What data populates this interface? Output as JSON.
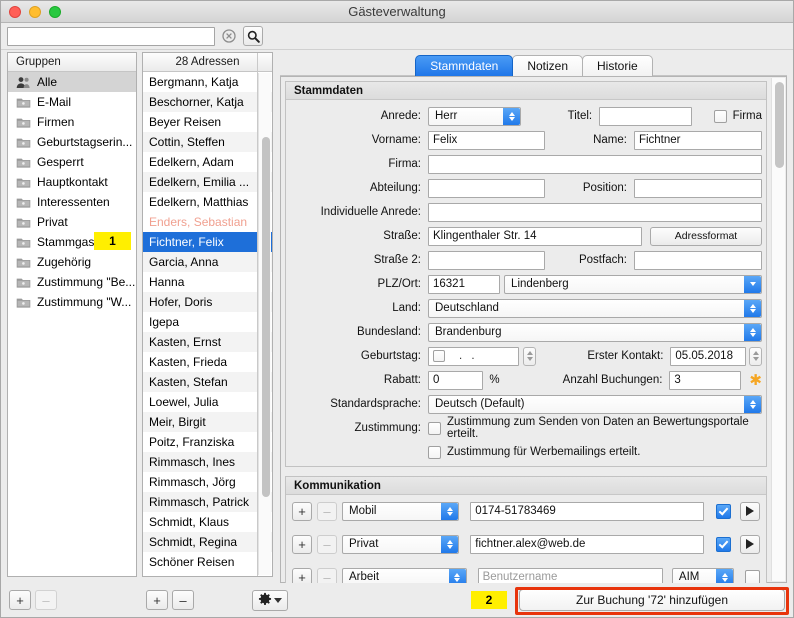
{
  "window": {
    "title": "Gästeverwaltung"
  },
  "toolbar": {
    "search_value": "",
    "search_placeholder": "",
    "clear_icon": "clear-circle-icon",
    "search_icon": "magnifier-icon"
  },
  "groups": {
    "header": "Gruppen",
    "items": [
      {
        "label": "Alle",
        "icon": "people-icon",
        "selected": true
      },
      {
        "label": "E-Mail",
        "icon": "folder-icon",
        "selected": false
      },
      {
        "label": "Firmen",
        "icon": "folder-icon",
        "selected": false
      },
      {
        "label": "Geburtstagserin...",
        "icon": "folder-icon",
        "selected": false
      },
      {
        "label": "Gesperrt",
        "icon": "folder-icon",
        "selected": false
      },
      {
        "label": "Hauptkontakt",
        "icon": "folder-icon",
        "selected": false
      },
      {
        "label": "Interessenten",
        "icon": "folder-icon",
        "selected": false
      },
      {
        "label": "Privat",
        "icon": "folder-icon",
        "selected": false
      },
      {
        "label": "Stammgast",
        "icon": "folder-icon",
        "selected": false
      },
      {
        "label": "Zugehörig",
        "icon": "folder-icon",
        "selected": false
      },
      {
        "label": "Zustimmung \"Be...",
        "icon": "folder-icon",
        "selected": false
      },
      {
        "label": "Zustimmung \"W...",
        "icon": "folder-icon",
        "selected": false
      }
    ]
  },
  "addresses": {
    "header": "28 Adressen",
    "items": [
      {
        "label": "Bergmann, Katja",
        "state": "normal"
      },
      {
        "label": "Beschorner, Katja",
        "state": "normal"
      },
      {
        "label": "Beyer Reisen",
        "state": "normal"
      },
      {
        "label": "Cottin, Steffen",
        "state": "normal"
      },
      {
        "label": "Edelkern, Adam",
        "state": "normal"
      },
      {
        "label": "Edelkern, Emilia ...",
        "state": "normal"
      },
      {
        "label": "Edelkern, Matthias",
        "state": "normal"
      },
      {
        "label": "Enders, Sebastian",
        "state": "disabled"
      },
      {
        "label": "Fichtner, Felix",
        "state": "selected"
      },
      {
        "label": "Garcia, Anna",
        "state": "normal"
      },
      {
        "label": "Hanna",
        "state": "normal"
      },
      {
        "label": "Hofer, Doris",
        "state": "normal"
      },
      {
        "label": "Igepa",
        "state": "normal"
      },
      {
        "label": "Kasten, Ernst",
        "state": "normal"
      },
      {
        "label": "Kasten, Frieda",
        "state": "normal"
      },
      {
        "label": "Kasten, Stefan",
        "state": "normal"
      },
      {
        "label": "Loewel, Julia",
        "state": "normal"
      },
      {
        "label": "Meir, Birgit",
        "state": "normal"
      },
      {
        "label": "Poitz, Franziska",
        "state": "normal"
      },
      {
        "label": "Rimmasch, Ines",
        "state": "normal"
      },
      {
        "label": "Rimmasch, Jörg",
        "state": "normal"
      },
      {
        "label": "Rimmasch, Patrick",
        "state": "normal"
      },
      {
        "label": "Schmidt, Klaus",
        "state": "normal"
      },
      {
        "label": "Schmidt, Regina",
        "state": "normal"
      },
      {
        "label": "Schöner Reisen",
        "state": "normal"
      }
    ]
  },
  "tabs": [
    {
      "label": "Stammdaten",
      "active": true
    },
    {
      "label": "Notizen",
      "active": false
    },
    {
      "label": "Historie",
      "active": false
    }
  ],
  "stammdaten": {
    "section_title": "Stammdaten",
    "anrede_label": "Anrede:",
    "anrede_value": "Herr",
    "titel_label": "Titel:",
    "titel_value": "",
    "firma_checkbox_label": "Firma",
    "vorname_label": "Vorname:",
    "vorname_value": "Felix",
    "name_label": "Name:",
    "name_value": "Fichtner",
    "firma_label": "Firma:",
    "firma_value": "",
    "abteilung_label": "Abteilung:",
    "abteilung_value": "",
    "position_label": "Position:",
    "position_value": "",
    "individuelle_anrede_label": "Individuelle Anrede:",
    "individuelle_anrede_value": "",
    "strasse_label": "Straße:",
    "strasse_value": "Klingenthaler Str. 14",
    "adressformat_button": "Adressformat",
    "strasse2_label": "Straße 2:",
    "strasse2_value": "",
    "postfach_label": "Postfach:",
    "postfach_value": "",
    "plz_ort_label": "PLZ/Ort:",
    "plz_value": "16321",
    "ort_value": "Lindenberg",
    "land_label": "Land:",
    "land_value": "Deutschland",
    "bundesland_label": "Bundesland:",
    "bundesland_value": "Brandenburg",
    "geburtstag_label": "Geburtstag:",
    "geburtstag_value": ".    .",
    "erster_kontakt_label": "Erster Kontakt:",
    "erster_kontakt_value": "05.05.2018",
    "rabatt_label": "Rabatt:",
    "rabatt_value": "0",
    "rabatt_unit": "%",
    "anzahl_buchungen_label": "Anzahl Buchungen:",
    "anzahl_buchungen_value": "3",
    "anzahl_buchungen_icon": "asterisk-icon",
    "standardsprache_label": "Standardsprache:",
    "standardsprache_value": "Deutsch (Default)",
    "zustimmung_label": "Zustimmung:",
    "zustimmung_1": "Zustimmung zum Senden von Daten an Bewertungsportale erteilt.",
    "zustimmung_2": "Zustimmung für Werbemailings erteilt."
  },
  "kommunikation": {
    "section_title": "Kommunikation",
    "add_label": "+",
    "remove_label": "–",
    "rows": [
      {
        "type": "Mobil",
        "value": "0174-51783469",
        "placeholder": "",
        "checked": true,
        "has_play": true,
        "sub_select": null
      },
      {
        "type": "Privat",
        "value": "fichtner.alex@web.de",
        "placeholder": "",
        "checked": true,
        "has_play": true,
        "sub_select": null
      },
      {
        "type": "Arbeit",
        "value": "",
        "placeholder": "Benutzername",
        "checked": false,
        "has_play": false,
        "sub_select": "AIM"
      }
    ]
  },
  "bottombar": {
    "group_add": "+",
    "group_remove": "–",
    "address_add": "+",
    "address_remove": "–",
    "gear_icon": "gear-icon",
    "cta_label": "Zur Buchung '72' hinzufügen"
  },
  "annotations": [
    {
      "id": "1",
      "label": "1"
    },
    {
      "id": "2",
      "label": "2"
    }
  ],
  "colors": {
    "accent_blue": "#1e6fd9",
    "marker_yellow": "#ffef00",
    "highlight_red": "#e8340c",
    "disabled_row": "#f0a090"
  }
}
